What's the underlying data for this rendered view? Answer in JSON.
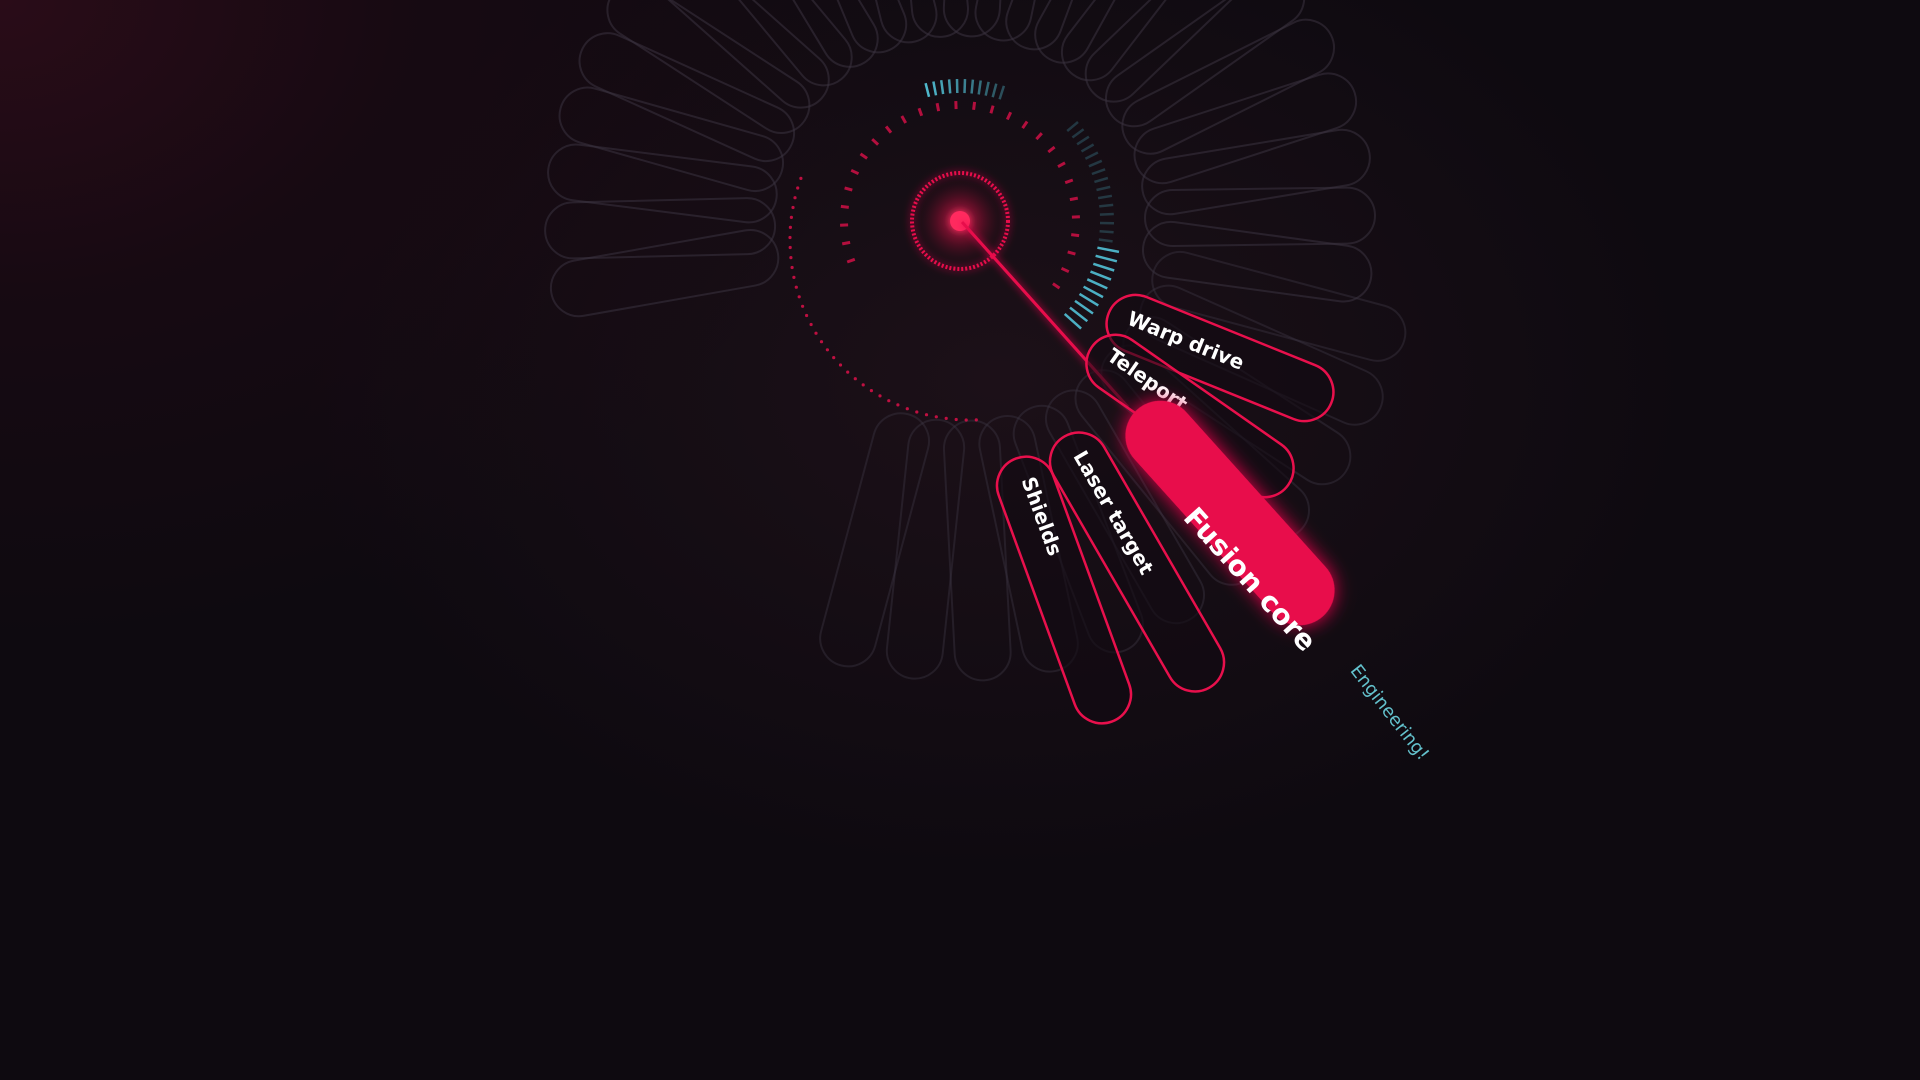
{
  "menu": {
    "items": [
      {
        "id": "warp-drive",
        "label": "Warp drive",
        "active": false
      },
      {
        "id": "teleport",
        "label": "Teleport",
        "active": false
      },
      {
        "id": "fusion-core",
        "label": "Fusion core",
        "active": true
      },
      {
        "id": "laser-target",
        "label": "Laser target",
        "active": false
      },
      {
        "id": "shields",
        "label": "Shields",
        "active": false
      }
    ],
    "status_text": "Engineering!"
  },
  "colors": {
    "accent": "#e8104c",
    "cyan": "#4fb8cc",
    "status": "#63c1cc",
    "ghost": "#3a3340",
    "background": "#0e0a10"
  },
  "icons": {
    "center": "reticle-icon"
  }
}
